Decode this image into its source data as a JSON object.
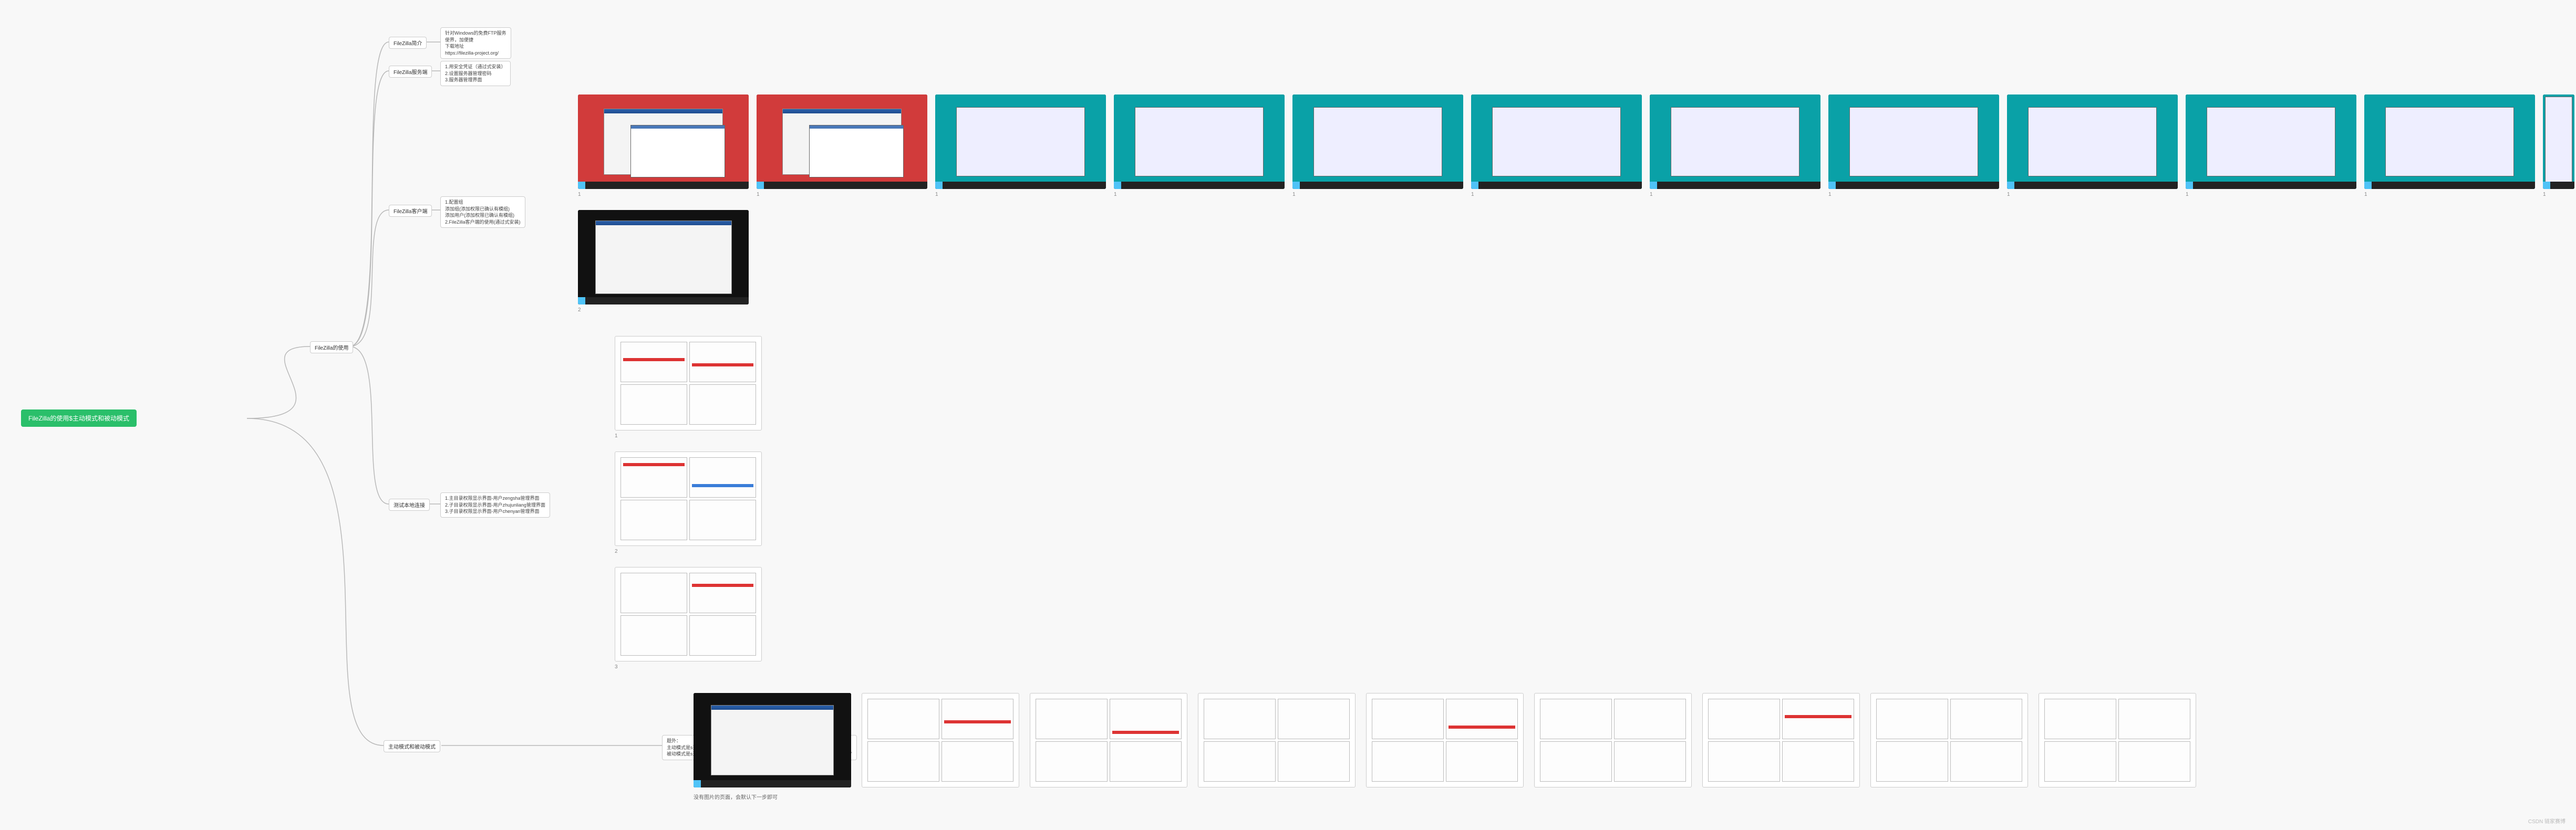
{
  "root": {
    "title": "FileZilla的使用$主动模式和被动模式"
  },
  "main_branches": {
    "usage": "FileZilla的使用",
    "mode": "主动模式和被动模式"
  },
  "usage_children": {
    "intro": {
      "label": "FileZilla简介",
      "lines": [
        "针对Windows的免费FTP服务",
        "使界，加便捷",
        "下载地址",
        "https://filezilla-project.org/"
      ]
    },
    "server": {
      "label": "FileZilla服务端",
      "lines": [
        "1.用安全凭证（通过式安装）",
        "2.设置服务器管理密码",
        "3.服务器管理界面"
      ]
    },
    "client": {
      "label": "FileZilla客户端",
      "lines": [
        "1.配置组",
        "添加组(添加权限已确认有模组)",
        "添加用户(添加权限已确认有模组)",
        "2.FileZilla客户端的使用(通过式安装)"
      ]
    },
    "test": {
      "label": "测试本地连接",
      "lines": [
        "1.主目录权限显示界面-用户zengsha管理界面",
        "2.子目录权限显示界面-用户zhujunliang管理界面",
        "3.子目录权限显示界面-用户chenyan管理界面"
      ]
    }
  },
  "mode_content": {
    "note_label": "题外：",
    "lines": [
      "主动模式是s通知s去抢饭，s立马备好了。",
      "被动模式是s通知s去抢饭，s没有立马备好，会：“不好意思，我去不了，但是我家来有空”"
    ],
    "caption": "没有图片的页面，会默认下一步即可"
  },
  "thumb_rows": {
    "client_row": {
      "count": 12,
      "labels": [
        "1",
        "1",
        "1",
        "1",
        "1",
        "1",
        "1",
        "1",
        "1",
        "1",
        "1",
        "1",
        "2"
      ]
    },
    "test_col": {
      "labels": [
        "1",
        "2",
        "3"
      ]
    },
    "mode_row": {
      "count": 9
    }
  },
  "watermark": "CSDN 链家赛博"
}
